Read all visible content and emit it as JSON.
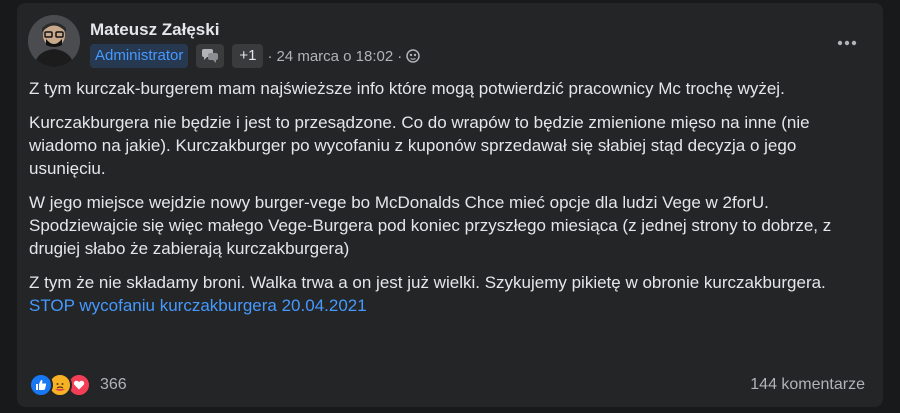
{
  "post": {
    "author": "Mateusz Załęski",
    "role_badge": "Administrator",
    "plus_label": "+1",
    "timestamp": "24 marca o 18:02",
    "paragraphs": [
      "Z tym kurczak-burgerem mam najświeższe info które mogą potwierdzić pracownicy Mc trochę wyżej.",
      "Kurczakburgera nie będzie i jest to przesądzone. Co do wrapów to będzie zmienione mięso na inne (nie wiadomo na jakie). Kurczakburger po wycofaniu z kuponów sprzedawał się słabiej stąd decyzja o jego usunięciu.",
      "W jego miejsce wejdzie nowy burger-vege bo McDonalds Chce mieć opcje dla ludzi Vege w 2forU. Spodziewajcie się więc małego Vege-Burgera pod koniec przyszłego miesiąca (z jednej strony to dobrze, z drugiej słabo że zabierają kurczakburgera)",
      "Z tym że nie składamy broni. Walka trwa a on jest już wielki. Szykujemy pikietę w obronie kurczakburgera."
    ],
    "link_text": "STOP wycofaniu kurczakburgera 20.04.2021",
    "reaction_count": "366",
    "comment_count": "144 komentarze",
    "reactions": [
      "like-icon",
      "care-icon",
      "love-icon"
    ],
    "colors": {
      "card": "#242526",
      "link": "#4599ff",
      "badge_bg": "#263951",
      "like": "#1877f2",
      "care": "#f7b125",
      "love": "#f33e58"
    }
  }
}
